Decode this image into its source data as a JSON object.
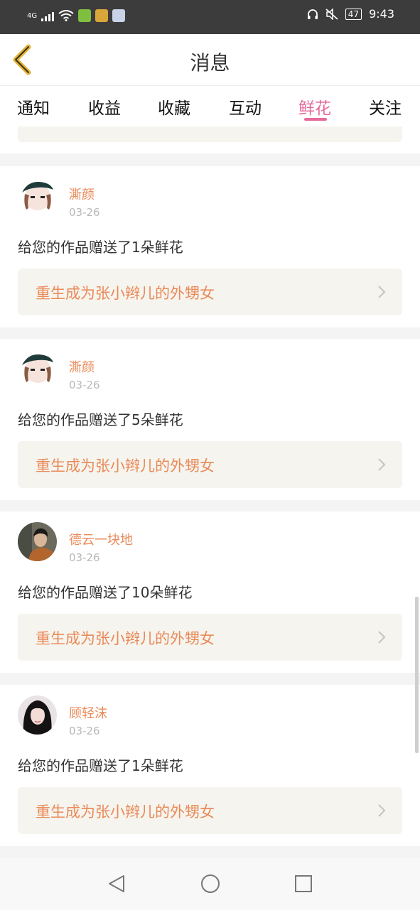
{
  "status": {
    "network": "4G",
    "battery": "47",
    "time": "9:43"
  },
  "header": {
    "title": "消息"
  },
  "tabs": [
    {
      "label": "通知"
    },
    {
      "label": "收益"
    },
    {
      "label": "收藏"
    },
    {
      "label": "互动"
    },
    {
      "label": "鲜花",
      "active": true
    },
    {
      "label": "关注"
    }
  ],
  "messages": [
    {
      "user": "澌颜",
      "date": "03-26",
      "text": "给您的作品赠送了1朵鲜花",
      "work": "重生成为张小辫儿的外甥女"
    },
    {
      "user": "澌颜",
      "date": "03-26",
      "text": "给您的作品赠送了5朵鲜花",
      "work": "重生成为张小辫儿的外甥女"
    },
    {
      "user": "德云一块地",
      "date": "03-26",
      "text": "给您的作品赠送了10朵鲜花",
      "work": "重生成为张小辫儿的外甥女"
    },
    {
      "user": "顾轻沫",
      "date": "03-26",
      "text": "给您的作品赠送了1朵鲜花",
      "work": "重生成为张小辫儿的外甥女"
    }
  ],
  "colors": {
    "accent": "#e66b9b",
    "link_text": "#e98a59",
    "link_bg": "#f6f4ee",
    "back_arrow": "#e2b23a"
  }
}
